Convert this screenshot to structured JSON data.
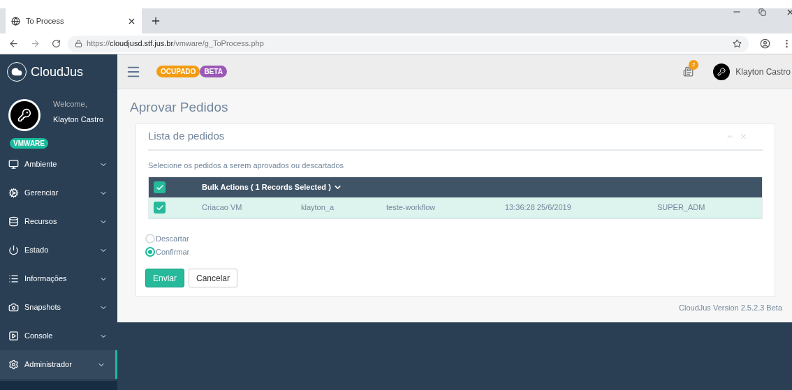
{
  "browser": {
    "tab_title": "To Process",
    "url": {
      "scheme": "https://",
      "host": "cloudjusd.stf.jus.br",
      "path": "/vmware/g_ToProcess.php"
    }
  },
  "brand": "CloudJus",
  "topbar": {
    "badges": [
      {
        "label": "OCUPADO",
        "color": "#f39c12"
      },
      {
        "label": "BETA",
        "color": "#9b59b6"
      }
    ],
    "notification_count": "2",
    "user": "Klayton Castro"
  },
  "profile": {
    "greeting": "Welcome,",
    "name": "Klayton Castro",
    "tag": "VMWARE"
  },
  "sidebar": {
    "items": [
      {
        "label": "Ambiente",
        "selected": false
      },
      {
        "label": "Gerenciar",
        "selected": false
      },
      {
        "label": "Recursos",
        "selected": false
      },
      {
        "label": "Estado",
        "selected": false
      },
      {
        "label": "Informações",
        "selected": false
      },
      {
        "label": "Snapshots",
        "selected": false
      },
      {
        "label": "Console",
        "selected": false
      },
      {
        "label": "Administrador",
        "selected": true
      }
    ]
  },
  "page_title": "Aprovar Pedidos",
  "panel": {
    "title": "Lista de pedidos",
    "instruction": "Selecione os pedidos a serem aprovados ou descartados",
    "table": {
      "header": {
        "checked": true,
        "bulk_label": "Bulk Actions ( 1 Records Selected )"
      },
      "rows": [
        {
          "checked": true,
          "cells": [
            "Criacao VM",
            "klayton_a",
            "teste-workflow",
            "13:36:28 25/6/2019",
            "SUPER_ADM"
          ]
        }
      ]
    },
    "options": [
      {
        "label": "Descartar",
        "selected": false
      },
      {
        "label": "Confirmar",
        "selected": true
      }
    ],
    "buttons": [
      {
        "label": "Enviar",
        "kind": "primary"
      },
      {
        "label": "Cancelar",
        "kind": "default"
      }
    ]
  },
  "footer": "CloudJus Version 2.5.2.3 Beta"
}
